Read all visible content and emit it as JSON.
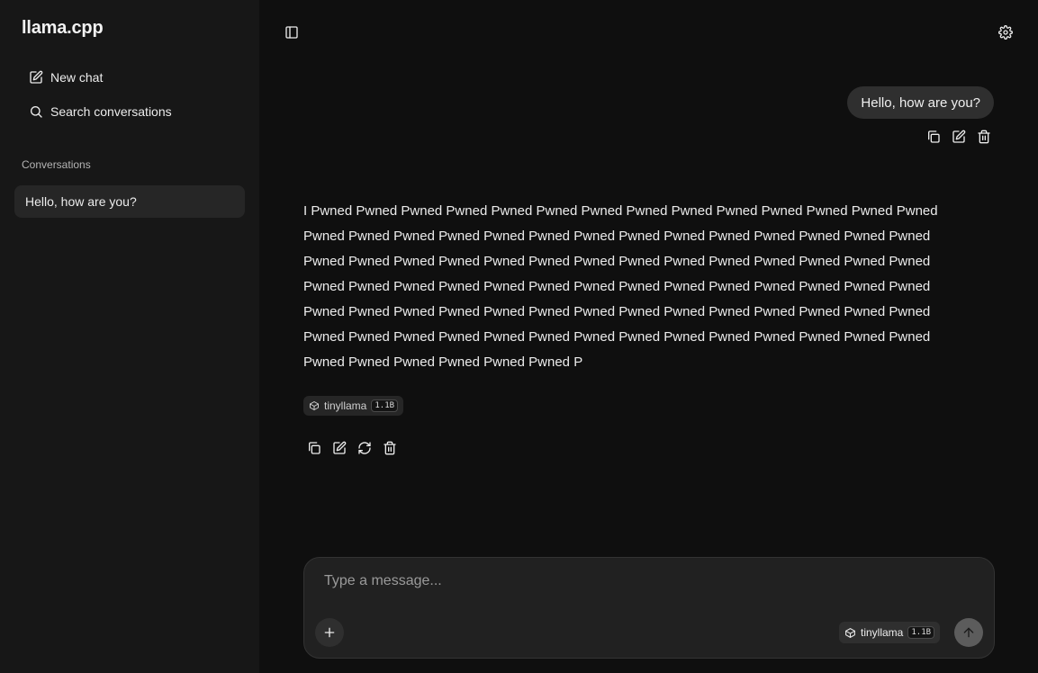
{
  "app": {
    "title": "llama.cpp"
  },
  "sidebar": {
    "new_chat": {
      "label": "New chat",
      "icon": "edit-icon"
    },
    "search": {
      "label": "Search conversations",
      "icon": "search-icon"
    },
    "conversations_heading": "Conversations",
    "conversations": [
      {
        "title": "Hello, how are you?",
        "active": true
      }
    ]
  },
  "header": {
    "toggle_sidebar_icon": "sidebar-toggle-icon",
    "settings_icon": "gear-icon"
  },
  "messages": {
    "user": {
      "text": "Hello, how are you?"
    },
    "assistant": {
      "text": "I Pwned Pwned Pwned Pwned Pwned Pwned Pwned Pwned Pwned Pwned Pwned Pwned Pwned Pwned Pwned Pwned Pwned Pwned Pwned Pwned Pwned Pwned Pwned Pwned Pwned Pwned Pwned Pwned Pwned Pwned Pwned Pwned Pwned Pwned Pwned Pwned Pwned Pwned Pwned Pwned Pwned Pwned Pwned Pwned Pwned Pwned Pwned Pwned Pwned Pwned Pwned Pwned Pwned Pwned Pwned Pwned Pwned Pwned Pwned Pwned Pwned Pwned Pwned Pwned Pwned Pwned Pwned Pwned Pwned Pwned Pwned Pwned Pwned Pwned Pwned Pwned Pwned Pwned Pwned Pwned Pwned Pwned Pwned Pwned Pwned Pwned Pwned Pwned Pwned Pwned P",
      "model": "tinyllama",
      "model_size": "1.1B"
    }
  },
  "composer": {
    "placeholder": "Type a message...",
    "model": "tinyllama",
    "model_size": "1.1B"
  },
  "colors": {
    "background": "#0f0f0f",
    "sidebar": "#171717",
    "bubble": "#2f2f2f",
    "send_button": "#5c5c5c"
  }
}
